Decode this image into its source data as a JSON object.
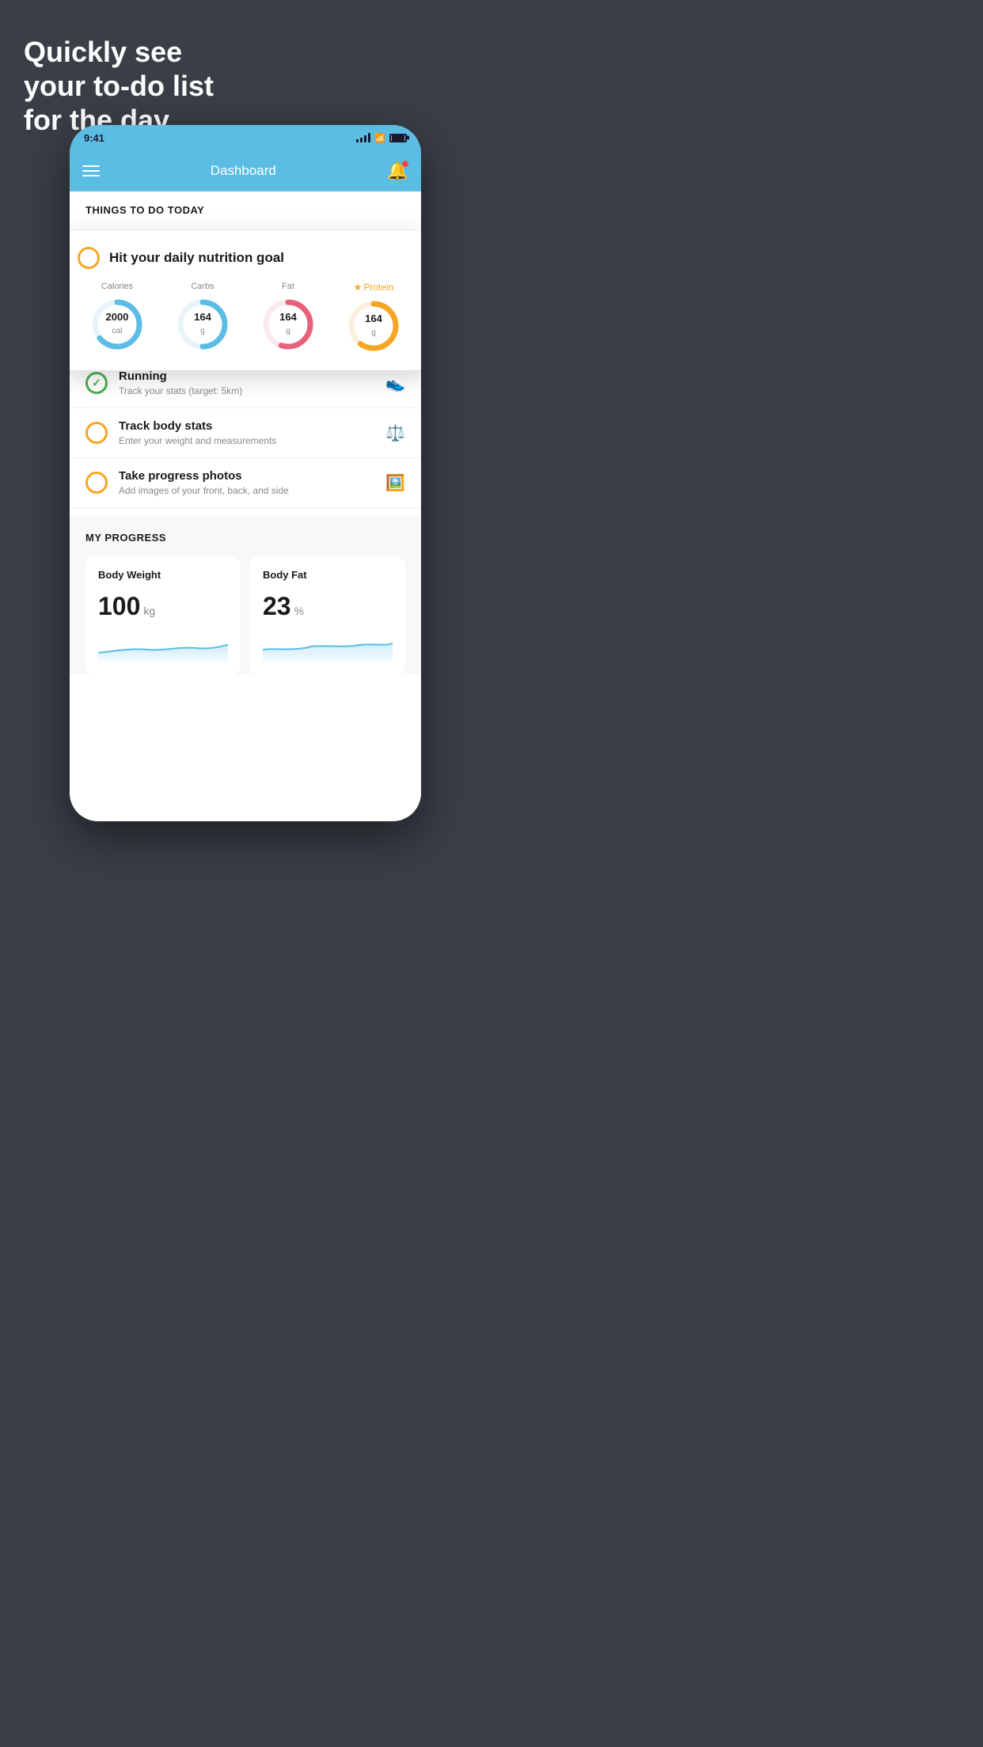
{
  "hero": {
    "line1": "Quickly see",
    "line2": "your to-do list",
    "line3": "for the day."
  },
  "phone": {
    "status": {
      "time": "9:41"
    },
    "nav": {
      "title": "Dashboard"
    },
    "section_header": "THINGS TO DO TODAY",
    "floating_card": {
      "title": "Hit your daily nutrition goal",
      "nutrition": [
        {
          "label": "Calories",
          "value": "2000",
          "unit": "cal",
          "color": "#5bbde4",
          "star": false,
          "percent": 65
        },
        {
          "label": "Carbs",
          "value": "164",
          "unit": "g",
          "color": "#5bbde4",
          "star": false,
          "percent": 50
        },
        {
          "label": "Fat",
          "value": "164",
          "unit": "g",
          "color": "#e8617a",
          "star": false,
          "percent": 55
        },
        {
          "label": "Protein",
          "value": "164",
          "unit": "g",
          "color": "#f5a623",
          "star": true,
          "percent": 60
        }
      ]
    },
    "todo_items": [
      {
        "title": "Running",
        "subtitle": "Track your stats (target: 5km)",
        "checked": true,
        "icon": "👟"
      },
      {
        "title": "Track body stats",
        "subtitle": "Enter your weight and measurements",
        "checked": false,
        "icon": "⚖️"
      },
      {
        "title": "Take progress photos",
        "subtitle": "Add images of your front, back, and side",
        "checked": false,
        "icon": "🖼️"
      }
    ],
    "progress": {
      "header": "MY PROGRESS",
      "cards": [
        {
          "title": "Body Weight",
          "value": "100",
          "unit": "kg"
        },
        {
          "title": "Body Fat",
          "value": "23",
          "unit": "%"
        }
      ]
    }
  }
}
